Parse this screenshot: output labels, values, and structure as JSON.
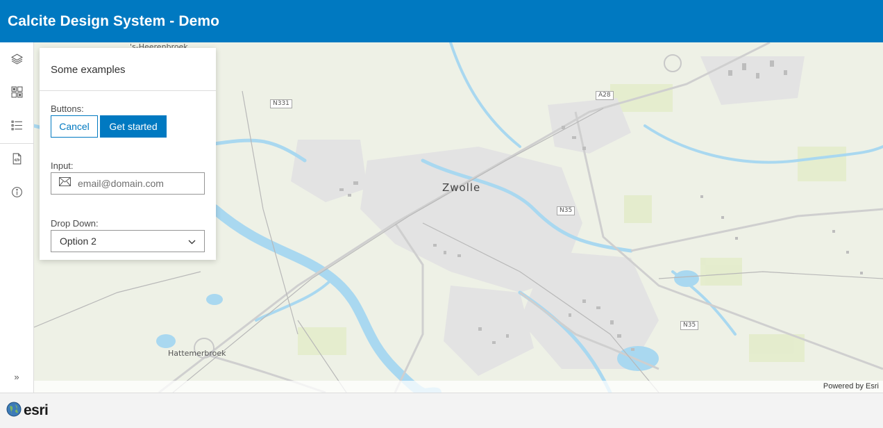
{
  "header": {
    "title": "Calcite Design System - Demo"
  },
  "action_bar": {
    "actions": [
      {
        "icon": "layers-icon"
      },
      {
        "icon": "basemap-icon"
      },
      {
        "icon": "legend-icon"
      },
      {
        "icon": "code-icon"
      },
      {
        "icon": "information-icon"
      }
    ],
    "collapse_glyph": "»"
  },
  "panel": {
    "heading": "Some examples",
    "buttons_label": "Buttons:",
    "cancel_label": "Cancel",
    "get_started_label": "Get started",
    "input_label": "Input:",
    "input_placeholder": "email@domain.com",
    "dropdown_label": "Drop Down:",
    "dropdown_value": "Option 2"
  },
  "map": {
    "labels": {
      "city": "Zwolle",
      "town": "Hattemerbroek",
      "top_fragment": "'s-Heerenbroek"
    },
    "shields": [
      "N331",
      "A28",
      "N35",
      "N35"
    ],
    "attribution": "Powered by Esri"
  },
  "footer": {
    "brand": "esri"
  },
  "colors": {
    "brand_blue": "#0079c1",
    "water": "#a9d8f0",
    "land": "#eef1e6"
  }
}
